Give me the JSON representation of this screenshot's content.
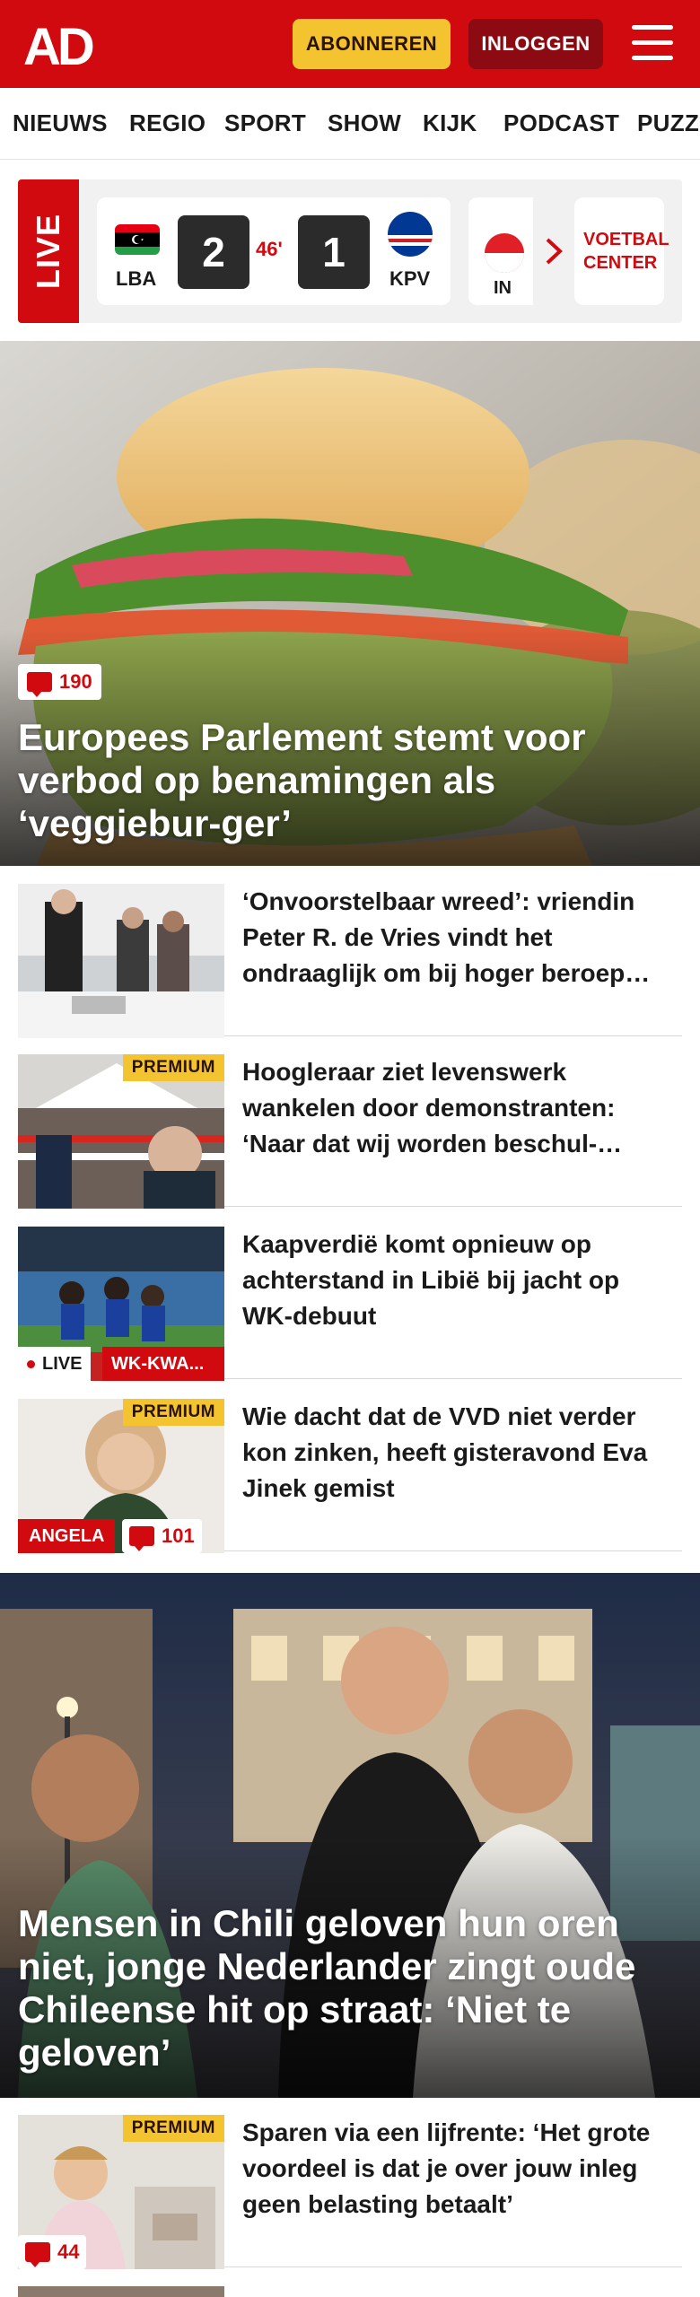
{
  "header": {
    "logo": "AD",
    "subscribe_label": "ABONNEREN",
    "login_label": "INLOGGEN",
    "brand_color": "#d10a10",
    "menu_icon": "hamburger-icon"
  },
  "nav": {
    "items": [
      "NIEUWS",
      "REGIO",
      "SPORT",
      "SHOW",
      "KIJK",
      "PODCAST",
      "PUZZ"
    ]
  },
  "live": {
    "label": "LIVE",
    "match": {
      "home": "LBA",
      "away": "KPV",
      "home_score": "2",
      "away_score": "1",
      "minute": "46'"
    },
    "next_match_partial": "IN",
    "voetbal_center": "VOETBAL CENTER"
  },
  "hero1": {
    "comments": "190",
    "title": "Europees Parlement stemt voor verbod op benamingen als ‘veggiebur-ger’"
  },
  "articles": [
    {
      "title": "‘Onvoorstelbaar wreed’: vriendin Peter R. de Vries vindt het ondraaglijk om bij hoger beroep…"
    },
    {
      "premium": "PREMIUM",
      "title": "Hoogleraar ziet levenswerk wankelen door demonstranten: ‘Naar dat wij worden beschul-…"
    },
    {
      "live": "LIVE",
      "tag": "WK-KWA...",
      "title": "Kaapverdië komt opnieuw op achterstand in Libië bij jacht op WK-debuut"
    },
    {
      "premium": "PREMIUM",
      "author": "ANGELA",
      "comments": "101",
      "title": "Wie dacht dat de VVD niet verder kon zinken, heeft gisteravond Eva Jinek gemist"
    }
  ],
  "hero2": {
    "title": "Mensen in Chili geloven hun oren niet, jonge Nederlander zingt oude Chileense hit op straat: ‘Niet te geloven’"
  },
  "article_after": {
    "premium": "PREMIUM",
    "comments": "44",
    "title": "Sparen via een lijfrente: ‘Het grote voordeel is dat je over jouw inleg geen belasting betaalt’"
  }
}
